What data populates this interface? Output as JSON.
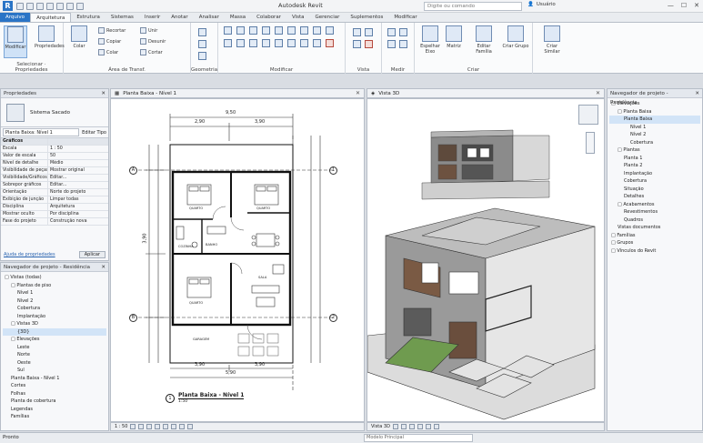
{
  "app": {
    "title": "Autodesk Revit",
    "logo": "R",
    "search_placeholder": "Digite ou comando",
    "user": "Usuário",
    "window_controls": [
      "—",
      "☐",
      "✕"
    ]
  },
  "tabs": [
    "Arquivo",
    "Arquitetura",
    "Estrutura",
    "Sistemas",
    "Inserir",
    "Anotar",
    "Analisar",
    "Massa",
    "Colaborar",
    "Vista",
    "Gerenciar",
    "Suplementos",
    "Modificar"
  ],
  "ribbon": {
    "modify_label": "Modificar",
    "select_label": "Selecionar",
    "properties_label": "Propriedades",
    "properties_group": "Propriedades",
    "paste_label": "Colar",
    "clipboard_items": [
      "Recortar",
      "Copiar",
      "Colar",
      "Unir",
      "Desunir",
      "Cortar"
    ],
    "clipboard_group": "Área de Transf.",
    "geometry_group": "Geometria",
    "modify_group": "Modificar",
    "view_group": "Vista",
    "measure_group": "Medir",
    "create_group": "Criar",
    "btn_mirror": "Espelhar Eixo",
    "btn_array": "Matriz",
    "btn_mode": "Editar Família",
    "btn_create": "Criar Grupo",
    "btn_similar": "Criar Similar"
  },
  "properties": {
    "title": "Propriedades",
    "close": "✕",
    "type_name": "Sistema Sacado",
    "view_selector": "Planta Baixa: Nível 1",
    "edit_type": "Editar Tipo",
    "rows": [
      {
        "k": "Gráficos",
        "v": "",
        "section": true
      },
      {
        "k": "Escala",
        "v": "1 : 50"
      },
      {
        "k": "Valor de escala",
        "v": "50"
      },
      {
        "k": "Nível de detalhe",
        "v": "Médio"
      },
      {
        "k": "Visibilidade de peças",
        "v": "Mostrar original"
      },
      {
        "k": "Visibilidade/Gráficos",
        "v": "Editar..."
      },
      {
        "k": "Sobrepor gráficos",
        "v": "Editar..."
      },
      {
        "k": "Orientação",
        "v": "Norte do projeto"
      },
      {
        "k": "Exibição de junção",
        "v": "Limpar todas"
      },
      {
        "k": "Disciplina",
        "v": "Arquitetura"
      },
      {
        "k": "Mostrar oculto",
        "v": "Por disciplina"
      },
      {
        "k": "Fase do projeto",
        "v": "Construção nova"
      }
    ],
    "help_link": "Ajuda de propriedades",
    "apply": "Aplicar"
  },
  "browser_left": {
    "title": "Navegador de projeto - Residência",
    "items": [
      {
        "label": "□ Vistas (todas)",
        "indent": 0
      },
      {
        "label": "□ Plantas de piso",
        "indent": 1
      },
      {
        "label": "Nível 1",
        "indent": 2
      },
      {
        "label": "Nível 2",
        "indent": 2
      },
      {
        "label": "Cobertura",
        "indent": 2
      },
      {
        "label": "Implantação",
        "indent": 2
      },
      {
        "label": "□ Vistas 3D",
        "indent": 1
      },
      {
        "label": "{3D}",
        "indent": 2,
        "hl": true
      },
      {
        "label": "□ Elevações",
        "indent": 1
      },
      {
        "label": "Leste",
        "indent": 2
      },
      {
        "label": "Norte",
        "indent": 2
      },
      {
        "label": "Oeste",
        "indent": 2
      },
      {
        "label": "Sul",
        "indent": 2
      },
      {
        "label": "Planta Baixa - Nível 1",
        "indent": 1
      },
      {
        "label": "Cortes",
        "indent": 1
      },
      {
        "label": "Folhas",
        "indent": 1
      },
      {
        "label": "Planta de cobertura",
        "indent": 1
      },
      {
        "label": "Legendas",
        "indent": 1
      },
      {
        "label": "Famílias",
        "indent": 1
      }
    ]
  },
  "browser_right": {
    "title": "Navegador de projeto - Residência",
    "items": [
      {
        "label": "□ Elevações",
        "indent": 0
      },
      {
        "label": "□ Planta Baixa",
        "indent": 1
      },
      {
        "label": "Planta Baixa",
        "indent": 2,
        "hl": true
      },
      {
        "label": "Nível 1",
        "indent": 3
      },
      {
        "label": "Nível 2",
        "indent": 3
      },
      {
        "label": "Cobertura",
        "indent": 3
      },
      {
        "label": "□ Plantas",
        "indent": 1
      },
      {
        "label": "Planta 1",
        "indent": 2
      },
      {
        "label": "Planta 2",
        "indent": 2
      },
      {
        "label": "Implantação",
        "indent": 2
      },
      {
        "label": "Cobertura",
        "indent": 2
      },
      {
        "label": "Situação",
        "indent": 2
      },
      {
        "label": "Detalhes",
        "indent": 2
      },
      {
        "label": "□ Acabamentos",
        "indent": 1
      },
      {
        "label": "Revestimentos",
        "indent": 2
      },
      {
        "label": "Quadros",
        "indent": 2
      },
      {
        "label": "Vistas documentos",
        "indent": 1
      },
      {
        "label": "□ Famílias",
        "indent": 0
      },
      {
        "label": "□ Grupos",
        "indent": 0
      },
      {
        "label": "□ Vínculos do Revit",
        "indent": 0
      }
    ]
  },
  "plan_view": {
    "tab_label": "Planta Baixa - Nível 1",
    "dimensions": [
      "9,50",
      "2,90",
      "3,90",
      "5,90",
      "3,90",
      "3,90",
      "3,90"
    ],
    "grid_bubbles": [
      "A",
      "B",
      "1",
      "2"
    ],
    "room_labels": [
      "QUARTO",
      "QUARTO",
      "BANHO",
      "SALA",
      "COZINHA",
      "QUARTO",
      "GARAGEM"
    ],
    "view_title": "Planta Baixa - Nível 1",
    "view_scale": "1:50",
    "bottom_scale": "1 : 50"
  },
  "view3d": {
    "tab_label": "Vista 3D",
    "bottom_label": "Vista 3D"
  },
  "status": {
    "left": "Pronto",
    "field": "Modelo Principal"
  }
}
